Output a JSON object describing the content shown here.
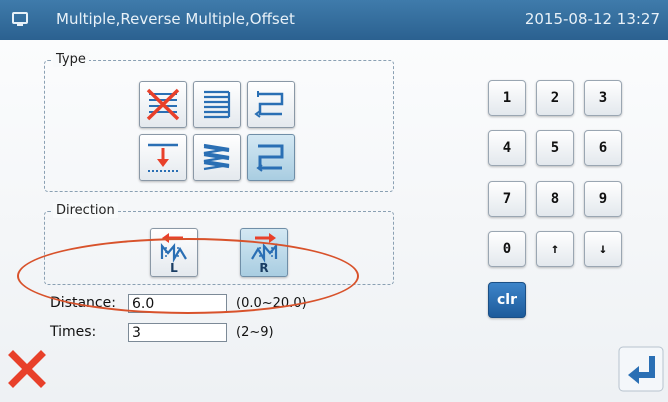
{
  "header": {
    "title": "Multiple,Reverse Multiple,Offset",
    "datetime": "2015-08-12 13:27",
    "icon": "display-icon"
  },
  "type_group": {
    "label": "Type",
    "buttons": [
      {
        "icon": "type-none-icon",
        "selected": false
      },
      {
        "icon": "type-multiple-icon",
        "selected": false
      },
      {
        "icon": "type-reverse-multiple-icon",
        "selected": false
      },
      {
        "icon": "type-offset-icon",
        "selected": false
      },
      {
        "icon": "type-zigzag-icon",
        "selected": false
      },
      {
        "icon": "type-reverse-offset-icon",
        "selected": true
      }
    ]
  },
  "direction_group": {
    "label": "Direction",
    "buttons": [
      {
        "icon": "direction-left-icon",
        "letter": "L",
        "selected": false
      },
      {
        "icon": "direction-right-icon",
        "letter": "R",
        "selected": true
      }
    ]
  },
  "fields": {
    "distance": {
      "label": "Distance:",
      "value": "6.0",
      "range": "(0.0~20.0)"
    },
    "times": {
      "label": "Times:",
      "value": "3",
      "range": "(2~9)"
    }
  },
  "keypad": {
    "keys": [
      "1",
      "2",
      "3",
      "4",
      "5",
      "6",
      "7",
      "8",
      "9",
      "0",
      "↑",
      "↓"
    ],
    "clear_label": "clr"
  },
  "actions": {
    "cancel_icon": "close-icon",
    "confirm_icon": "enter-icon"
  },
  "colors": {
    "titlebar": "#2f6a9a",
    "accent_red": "#e8402a",
    "accent_blue": "#2a6fb4",
    "highlight_oval": "#d8522b"
  }
}
